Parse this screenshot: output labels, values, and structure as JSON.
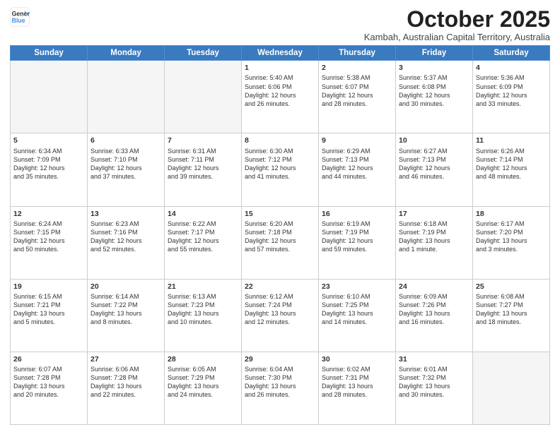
{
  "header": {
    "logo_line1": "General",
    "logo_line2": "Blue",
    "month_title": "October 2025",
    "subtitle": "Kambah, Australian Capital Territory, Australia"
  },
  "weekdays": [
    "Sunday",
    "Monday",
    "Tuesday",
    "Wednesday",
    "Thursday",
    "Friday",
    "Saturday"
  ],
  "weeks": [
    [
      {
        "day": "",
        "info": ""
      },
      {
        "day": "",
        "info": ""
      },
      {
        "day": "",
        "info": ""
      },
      {
        "day": "1",
        "info": "Sunrise: 5:40 AM\nSunset: 6:06 PM\nDaylight: 12 hours\nand 26 minutes."
      },
      {
        "day": "2",
        "info": "Sunrise: 5:38 AM\nSunset: 6:07 PM\nDaylight: 12 hours\nand 28 minutes."
      },
      {
        "day": "3",
        "info": "Sunrise: 5:37 AM\nSunset: 6:08 PM\nDaylight: 12 hours\nand 30 minutes."
      },
      {
        "day": "4",
        "info": "Sunrise: 5:36 AM\nSunset: 6:09 PM\nDaylight: 12 hours\nand 33 minutes."
      }
    ],
    [
      {
        "day": "5",
        "info": "Sunrise: 6:34 AM\nSunset: 7:09 PM\nDaylight: 12 hours\nand 35 minutes."
      },
      {
        "day": "6",
        "info": "Sunrise: 6:33 AM\nSunset: 7:10 PM\nDaylight: 12 hours\nand 37 minutes."
      },
      {
        "day": "7",
        "info": "Sunrise: 6:31 AM\nSunset: 7:11 PM\nDaylight: 12 hours\nand 39 minutes."
      },
      {
        "day": "8",
        "info": "Sunrise: 6:30 AM\nSunset: 7:12 PM\nDaylight: 12 hours\nand 41 minutes."
      },
      {
        "day": "9",
        "info": "Sunrise: 6:29 AM\nSunset: 7:13 PM\nDaylight: 12 hours\nand 44 minutes."
      },
      {
        "day": "10",
        "info": "Sunrise: 6:27 AM\nSunset: 7:13 PM\nDaylight: 12 hours\nand 46 minutes."
      },
      {
        "day": "11",
        "info": "Sunrise: 6:26 AM\nSunset: 7:14 PM\nDaylight: 12 hours\nand 48 minutes."
      }
    ],
    [
      {
        "day": "12",
        "info": "Sunrise: 6:24 AM\nSunset: 7:15 PM\nDaylight: 12 hours\nand 50 minutes."
      },
      {
        "day": "13",
        "info": "Sunrise: 6:23 AM\nSunset: 7:16 PM\nDaylight: 12 hours\nand 52 minutes."
      },
      {
        "day": "14",
        "info": "Sunrise: 6:22 AM\nSunset: 7:17 PM\nDaylight: 12 hours\nand 55 minutes."
      },
      {
        "day": "15",
        "info": "Sunrise: 6:20 AM\nSunset: 7:18 PM\nDaylight: 12 hours\nand 57 minutes."
      },
      {
        "day": "16",
        "info": "Sunrise: 6:19 AM\nSunset: 7:19 PM\nDaylight: 12 hours\nand 59 minutes."
      },
      {
        "day": "17",
        "info": "Sunrise: 6:18 AM\nSunset: 7:19 PM\nDaylight: 13 hours\nand 1 minute."
      },
      {
        "day": "18",
        "info": "Sunrise: 6:17 AM\nSunset: 7:20 PM\nDaylight: 13 hours\nand 3 minutes."
      }
    ],
    [
      {
        "day": "19",
        "info": "Sunrise: 6:15 AM\nSunset: 7:21 PM\nDaylight: 13 hours\nand 5 minutes."
      },
      {
        "day": "20",
        "info": "Sunrise: 6:14 AM\nSunset: 7:22 PM\nDaylight: 13 hours\nand 8 minutes."
      },
      {
        "day": "21",
        "info": "Sunrise: 6:13 AM\nSunset: 7:23 PM\nDaylight: 13 hours\nand 10 minutes."
      },
      {
        "day": "22",
        "info": "Sunrise: 6:12 AM\nSunset: 7:24 PM\nDaylight: 13 hours\nand 12 minutes."
      },
      {
        "day": "23",
        "info": "Sunrise: 6:10 AM\nSunset: 7:25 PM\nDaylight: 13 hours\nand 14 minutes."
      },
      {
        "day": "24",
        "info": "Sunrise: 6:09 AM\nSunset: 7:26 PM\nDaylight: 13 hours\nand 16 minutes."
      },
      {
        "day": "25",
        "info": "Sunrise: 6:08 AM\nSunset: 7:27 PM\nDaylight: 13 hours\nand 18 minutes."
      }
    ],
    [
      {
        "day": "26",
        "info": "Sunrise: 6:07 AM\nSunset: 7:28 PM\nDaylight: 13 hours\nand 20 minutes."
      },
      {
        "day": "27",
        "info": "Sunrise: 6:06 AM\nSunset: 7:28 PM\nDaylight: 13 hours\nand 22 minutes."
      },
      {
        "day": "28",
        "info": "Sunrise: 6:05 AM\nSunset: 7:29 PM\nDaylight: 13 hours\nand 24 minutes."
      },
      {
        "day": "29",
        "info": "Sunrise: 6:04 AM\nSunset: 7:30 PM\nDaylight: 13 hours\nand 26 minutes."
      },
      {
        "day": "30",
        "info": "Sunrise: 6:02 AM\nSunset: 7:31 PM\nDaylight: 13 hours\nand 28 minutes."
      },
      {
        "day": "31",
        "info": "Sunrise: 6:01 AM\nSunset: 7:32 PM\nDaylight: 13 hours\nand 30 minutes."
      },
      {
        "day": "",
        "info": ""
      }
    ]
  ]
}
